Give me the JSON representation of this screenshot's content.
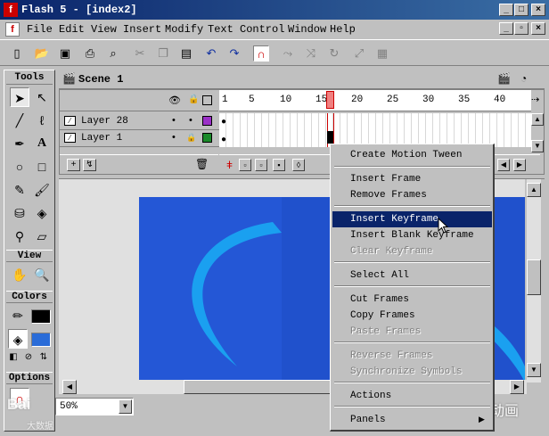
{
  "window": {
    "title": "Flash 5 - [index2]"
  },
  "menu": [
    "File",
    "Edit",
    "View",
    "Insert",
    "Modify",
    "Text",
    "Control",
    "Window",
    "Help"
  ],
  "scene": {
    "label": "Scene 1"
  },
  "tools": {
    "header": "Tools",
    "view_header": "View",
    "colors_header": "Colors",
    "options_header": "Options"
  },
  "timeline": {
    "ruler": [
      "1",
      "5",
      "10",
      "15",
      "20",
      "25",
      "30",
      "35",
      "40"
    ],
    "playhead_frame": 15,
    "layers": [
      {
        "name": "Layer 28",
        "color": "#9b30c8"
      },
      {
        "name": "Layer 1",
        "color": "#1a8a2a"
      }
    ]
  },
  "stage": {
    "zoom": "50%",
    "bg_color": "#2457d6",
    "arc_color": "#1aa0f0"
  },
  "context_menu": {
    "items": [
      {
        "label": "Create Motion Tween",
        "enabled": true
      },
      {
        "sep": true
      },
      {
        "label": "Insert Frame",
        "enabled": true
      },
      {
        "label": "Remove Frames",
        "enabled": true
      },
      {
        "sep": true
      },
      {
        "label": "Insert Keyframe",
        "enabled": true,
        "selected": true
      },
      {
        "label": "Insert Blank Keyframe",
        "enabled": true
      },
      {
        "label": "Clear Keyframe",
        "enabled": false
      },
      {
        "sep": true
      },
      {
        "label": "Select All",
        "enabled": true
      },
      {
        "sep": true
      },
      {
        "label": "Cut Frames",
        "enabled": true
      },
      {
        "label": "Copy Frames",
        "enabled": true
      },
      {
        "label": "Paste Frames",
        "enabled": false
      },
      {
        "sep": true
      },
      {
        "label": "Reverse Frames",
        "enabled": false
      },
      {
        "label": "Synchronize Symbols",
        "enabled": false
      },
      {
        "sep": true
      },
      {
        "label": "Actions",
        "enabled": true
      },
      {
        "sep": true
      },
      {
        "label": "Panels",
        "enabled": true,
        "submenu": true
      }
    ]
  },
  "watermarks": {
    "left": "Bai",
    "left_sub": "大数据",
    "right": "好传动画"
  }
}
